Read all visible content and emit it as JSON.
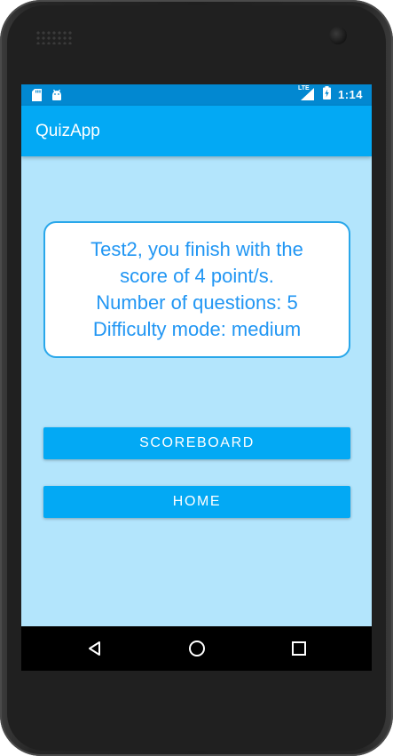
{
  "status_bar": {
    "time": "1:14",
    "network_label": "LTE",
    "left_icons": [
      "sd-card-icon",
      "android-icon"
    ],
    "right_icons": [
      "signal-icon",
      "battery-charging-icon"
    ]
  },
  "app_bar": {
    "title": "QuizApp"
  },
  "result": {
    "lines": [
      "Test2, you finish with the",
      "score of 4 point/s.",
      "Number of questions: 5",
      "Difficulty mode: medium"
    ]
  },
  "buttons": {
    "scoreboard": "SCOREBOARD",
    "home": "HOME"
  },
  "nav_bar": {
    "icons": [
      "back-icon",
      "home-icon",
      "recents-icon"
    ]
  },
  "colors": {
    "background": "#b3e5fc",
    "primary": "#03a9f4",
    "status_bar": "#0288d1",
    "card_text": "#2196f3"
  }
}
